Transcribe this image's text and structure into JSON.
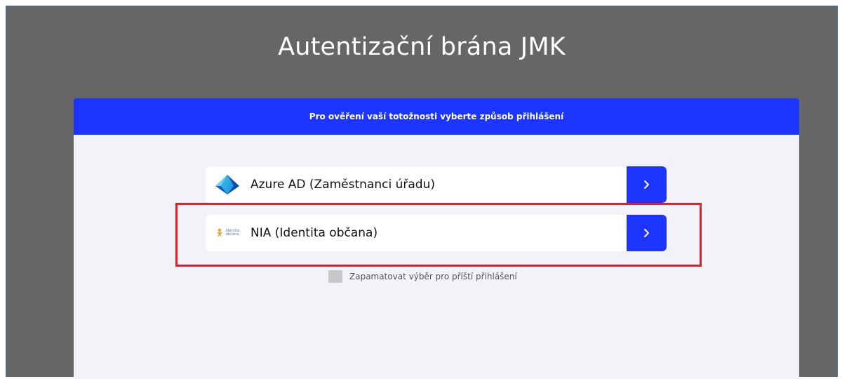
{
  "page": {
    "title": "Autentizační brána JMK"
  },
  "card": {
    "header_text": "Pro ověření vaší totožnosti vyberte způsob přihlášení"
  },
  "options": [
    {
      "label": "Azure AD (Zaměstnanci úřadu)",
      "icon": "azure-ad-icon",
      "arrow": "›"
    },
    {
      "label": "NIA (Identita občana)",
      "icon": "identita-obcana-logo",
      "logo_text": [
        "Identita",
        "občana"
      ],
      "arrow": "›"
    }
  ],
  "remember": {
    "label": "Zapamatovat výběr pro příští přihlášení",
    "checked": false
  },
  "colors": {
    "background": "#666666",
    "accent": "#1c34fc",
    "card": "#f2f2f8",
    "highlight": "#e3202a"
  }
}
